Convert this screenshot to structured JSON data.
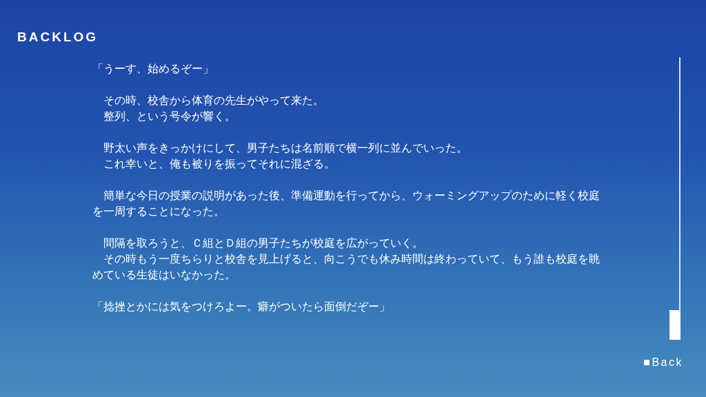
{
  "screen": {
    "title": "BACKLOG"
  },
  "blocks": [
    {
      "paragraphs": [
        "「うーす、始めるぞー」"
      ]
    },
    {
      "paragraphs": [
        "　その時、校舎から体育の先生がやって来た。",
        "　整列、という号令が響く。"
      ]
    },
    {
      "paragraphs": [
        "　野太い声をきっかけにして、男子たちは名前順で横一列に並んでいった。",
        "　これ幸いと、俺も被りを振ってそれに混ざる。"
      ]
    },
    {
      "paragraphs": [
        "　簡単な今日の授業の説明があった後、準備運動を行ってから、ウォーミングアップのために軽く校庭を一周することになった。"
      ]
    },
    {
      "paragraphs": [
        "　間隔を取ろうと、Ｃ組とＤ組の男子たちが校庭を広がっていく。",
        "　その時もう一度ちらりと校舎を見上げると、向こうでも休み時間は終わっていて、もう誰も校庭を眺めている生徒はいなかった。"
      ]
    },
    {
      "paragraphs": [
        "「捻挫とかには気をつけろよー。癖がついたら面倒だぞー」"
      ]
    }
  ],
  "back_button": {
    "label": "Back"
  }
}
